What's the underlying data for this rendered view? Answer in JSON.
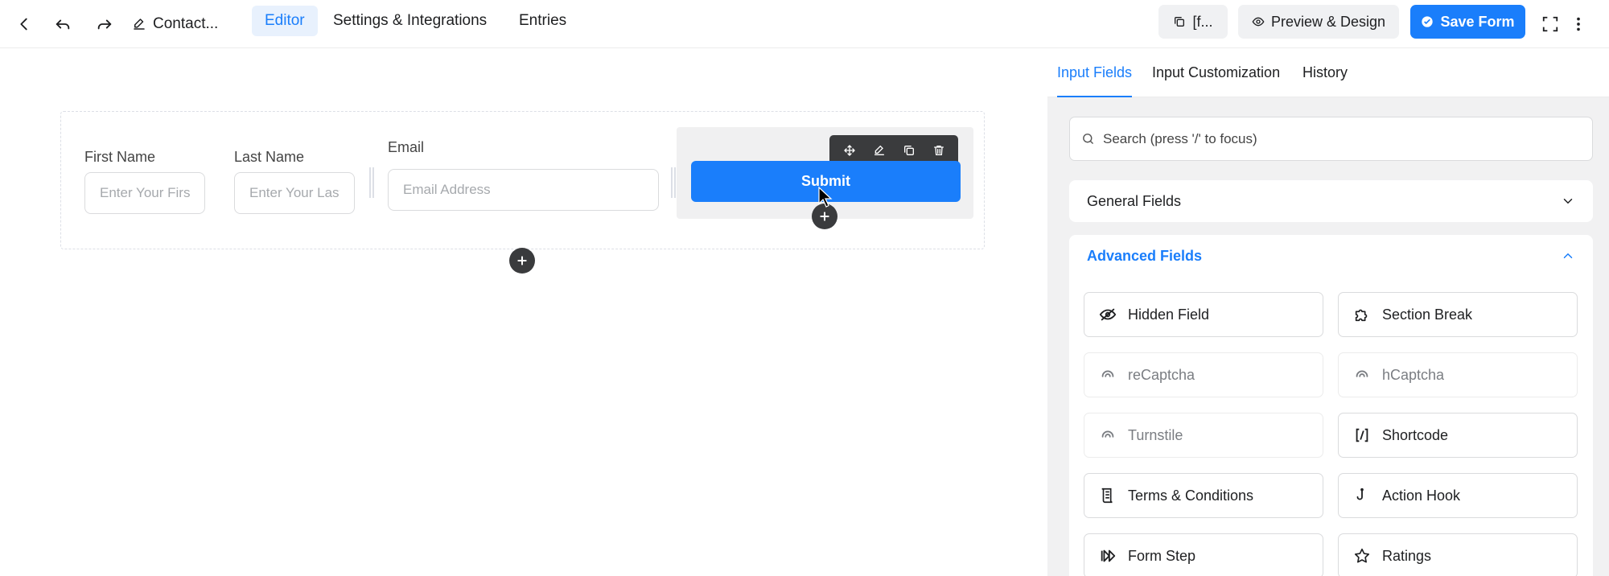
{
  "topbar": {
    "form_title": "Contact...",
    "tabs": [
      {
        "label": "Editor",
        "active": true
      },
      {
        "label": "Settings & Integrations",
        "active": false
      },
      {
        "label": "Entries",
        "active": false
      }
    ],
    "shortcode_label": "[f...",
    "preview_label": "Preview & Design",
    "save_label": "Save Form"
  },
  "form": {
    "first_name": {
      "label": "First Name",
      "placeholder": "Enter Your First Name"
    },
    "last_name": {
      "label": "Last Name",
      "placeholder": "Enter Your Last Name"
    },
    "email": {
      "label": "Email",
      "placeholder": "Email Address"
    },
    "submit_label": "Submit"
  },
  "sidebar": {
    "tabs": [
      {
        "label": "Input Fields",
        "active": true
      },
      {
        "label": "Input Customization",
        "active": false
      },
      {
        "label": "History",
        "active": false
      }
    ],
    "search_placeholder": "Search (press '/' to focus)",
    "general_fields": "General Fields",
    "advanced_fields": "Advanced Fields",
    "items": [
      {
        "label": "Hidden Field",
        "icon": "eye-slash-icon",
        "disabled": false
      },
      {
        "label": "Section Break",
        "icon": "puzzle-icon",
        "disabled": false
      },
      {
        "label": "reCaptcha",
        "icon": "captcha-icon",
        "disabled": true
      },
      {
        "label": "hCaptcha",
        "icon": "captcha-icon",
        "disabled": true
      },
      {
        "label": "Turnstile",
        "icon": "captcha-icon",
        "disabled": true
      },
      {
        "label": "Shortcode",
        "icon": "shortcode-icon",
        "disabled": false
      },
      {
        "label": "Terms & Conditions",
        "icon": "document-icon",
        "disabled": false
      },
      {
        "label": "Action Hook",
        "icon": "hook-icon",
        "disabled": false
      },
      {
        "label": "Form Step",
        "icon": "step-forward-icon",
        "disabled": false
      },
      {
        "label": "Ratings",
        "icon": "star-icon",
        "disabled": false
      }
    ]
  },
  "colors": {
    "accent": "#1a7efb",
    "dark": "#3a3b3d",
    "sidebar_bg": "#f1f1f2"
  }
}
